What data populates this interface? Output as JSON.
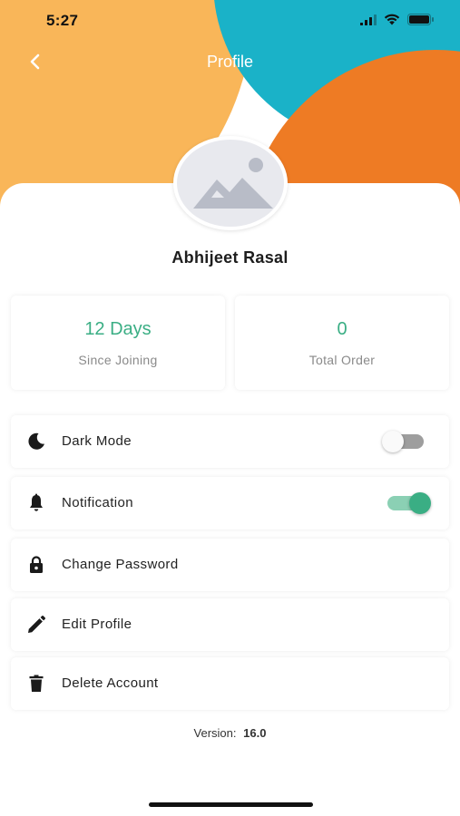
{
  "status_bar": {
    "time": "5:27"
  },
  "header": {
    "title": "Profile"
  },
  "profile": {
    "name": "Abhijeet Rasal"
  },
  "stats": [
    {
      "value": "12 Days",
      "label": "Since Joining"
    },
    {
      "value": "0",
      "label": "Total Order"
    }
  ],
  "menu": [
    {
      "label": "Dark Mode",
      "icon": "moon-icon",
      "toggle": "off"
    },
    {
      "label": "Notification",
      "icon": "bell-icon",
      "toggle": "on"
    },
    {
      "label": "Change Password",
      "icon": "lock-icon"
    },
    {
      "label": "Edit Profile",
      "icon": "pencil-icon"
    },
    {
      "label": "Delete Account",
      "icon": "trash-icon"
    }
  ],
  "footer": {
    "version_label": "Version:",
    "version_number": "16.0"
  },
  "colors": {
    "accent_green": "#3AAE84",
    "header_orange_light": "#F9B659",
    "header_teal": "#1AB2C8",
    "header_orange_dark": "#EE7B24"
  }
}
